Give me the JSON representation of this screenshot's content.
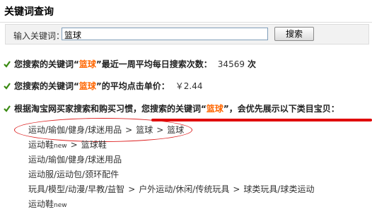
{
  "page": {
    "title": "关键词查询"
  },
  "search": {
    "label": "输入关键词：",
    "value": "篮球",
    "button_label": "搜索"
  },
  "stats": {
    "row1_prefix": "您搜索的关键词“",
    "keyword": "篮球",
    "row1_suffix": "”最近一周平均每日搜索次数：",
    "row1_value": "34569",
    "row1_unit": "次",
    "row2_prefix": "您搜索的关键词“",
    "row2_suffix": "”的平均点击单价：",
    "row2_value": "￥2.44",
    "row3_text_a": "根据淘宝网买家搜索和购买习惯，",
    "row3_text_b": "您搜索的关键词“",
    "row3_text_c": "”，会优先展示以下类目宝贝："
  },
  "categories": [
    {
      "parts": [
        "运动/瑜伽/健身/球迷用品",
        "篮球",
        "篮球"
      ]
    },
    {
      "parts": [
        "运动鞋",
        "篮球鞋"
      ],
      "suffix": "new"
    },
    {
      "parts": [
        "运动/瑜伽/健身/球迷用品"
      ]
    },
    {
      "parts": [
        "运动服/运动包/颈环配件"
      ]
    },
    {
      "parts": [
        "玩具/模型/动漫/早教/益智",
        "户外运动/休闲/传统玩具",
        "球类玩具/球类运动"
      ]
    },
    {
      "parts": [
        "运动鞋"
      ],
      "suffix": "new"
    }
  ],
  "colors": {
    "keyword": "#ff6600",
    "bullet_green": "#3a8a12",
    "annotation_red": "#e00000"
  },
  "separator": ">"
}
